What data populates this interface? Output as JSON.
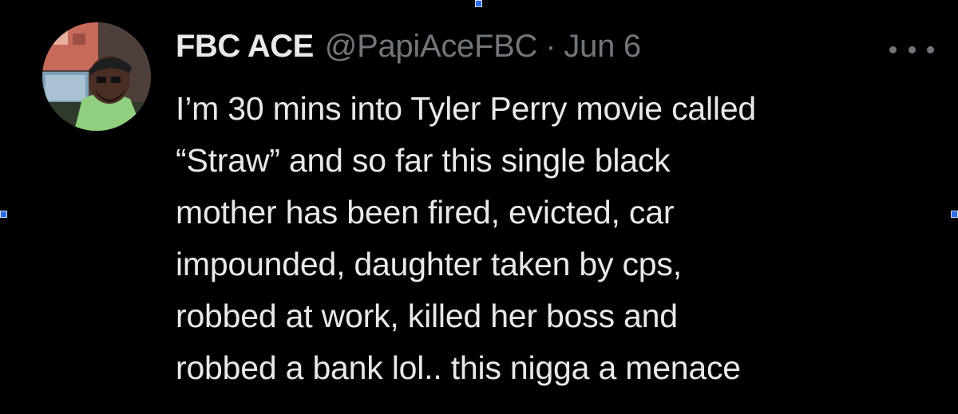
{
  "tweet": {
    "display_name": "FBC ACE",
    "handle": "@PapiAceFBC",
    "separator": "·",
    "date": "Jun 6",
    "text_lines": [
      "I’m 30 mins into Tyler Perry movie called",
      "“Straw” and so far this single black",
      "mother has been fired, evicted, car",
      "impounded, daughter taken by cps,",
      "robbed at work, killed her boss and",
      "robbed a bank lol.. this nigga a menace"
    ]
  },
  "icons": {
    "more": "more-horizontal-icon",
    "avatar": "profile-avatar"
  },
  "colors": {
    "background": "#000000",
    "primary_text": "#e7e9ea",
    "secondary_text": "#71767b",
    "selection_handle": "#2e6be6"
  }
}
